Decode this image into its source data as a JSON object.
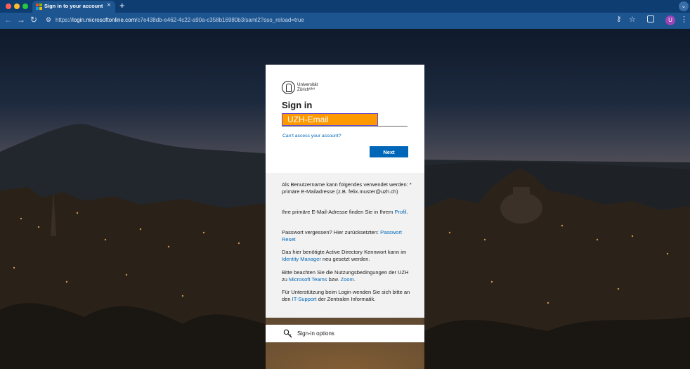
{
  "browser": {
    "tab_title": "Sign in to your account",
    "new_tab_label": "+",
    "url_prefix": "https://",
    "url_host": "login.microsoftonline.com",
    "url_path": "/c7e438db-e462-4c22-a90a-c358b16980b3/saml2?sso_reload=true",
    "profile_initial": "U",
    "icons": [
      "back-icon",
      "forward-icon",
      "reload-icon",
      "site-settings-icon",
      "key-icon",
      "star-icon",
      "extensions-icon",
      "kebab-icon",
      "tab-menu-icon"
    ]
  },
  "signin": {
    "logo_line1": "Universität",
    "logo_line2": "Zürichᵁᵏᴴ",
    "title": "Sign in",
    "email_placeholder": "UZH-Email",
    "email_value": "",
    "cant_access": "Can’t access your account?",
    "next_label": "Next"
  },
  "info": {
    "p1": "Als Benutzername kann folgendes verwendet werden: * primäre E-Mailadresse (z.B. felix.muster@uzh.ch)",
    "p2_text": "Ihre primäre E-Mail-Adresse finden Sie in Ihrem ",
    "p2_link": "Profil",
    "p2_end": ".",
    "p3_text": "Passwort vergessen? Hier zurücksetzten: ",
    "p3_link": "Passwort Reset",
    "p4_text1": "Das hier benötigte Active Directory Kennwort kann im ",
    "p4_link": "Identity Manager",
    "p4_text2": " neu gesetzt werden.",
    "p5_text1": "Bitte beachten Sie die Nutzungsbedingungen der UZH zu ",
    "p5_link1": "Microsoft Teams",
    "p5_text2": " bzw. ",
    "p5_link2": "Zoom",
    "p5_end": ".",
    "p6_text1": "Für Unterstützung beim Login wenden Sie sich bitte an den ",
    "p6_link": "IT-Support",
    "p6_text2": " der Zentralen Informatik."
  },
  "options": {
    "label": "Sign-in options",
    "icon": "key-search-icon"
  },
  "colors": {
    "tabbar": "#0e3d72",
    "toolbar": "#1d5590",
    "link": "#0067b8",
    "primary_button": "#0067b8",
    "email_highlight": "#ff9900"
  }
}
